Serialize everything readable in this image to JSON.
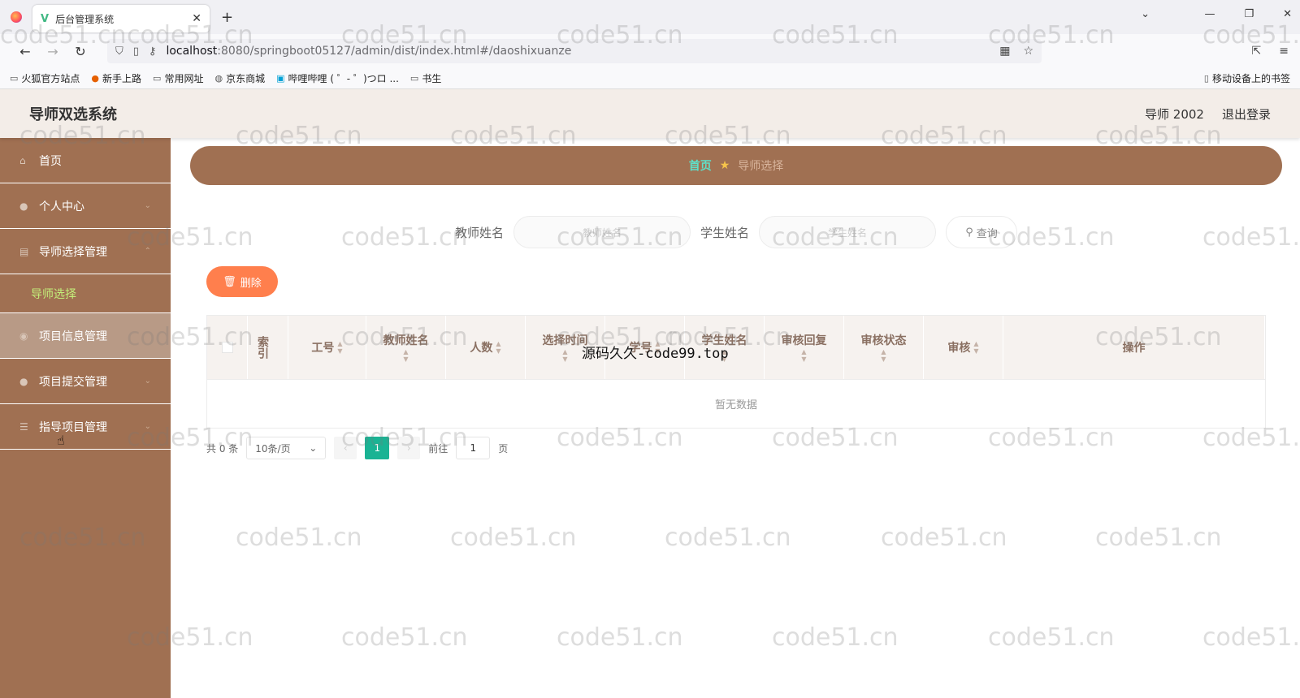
{
  "browser": {
    "tab_title": "后台管理系统",
    "url_host": "localhost",
    "url_path": ":8080/springboot05127/admin/dist/index.html#/daoshixuanze",
    "bookmarks": [
      "火狐官方站点",
      "新手上路",
      "常用网址",
      "京东商城",
      "哔哩哔哩 ( ゜- ゜)つロ ...",
      "书生"
    ],
    "mobile_bookmarks": "移动设备上的书签"
  },
  "header": {
    "title": "导师双选系统",
    "user": "导师 2002",
    "logout": "退出登录"
  },
  "sidebar": {
    "items": [
      {
        "label": "首页",
        "icon": "home-icon"
      },
      {
        "label": "个人中心",
        "icon": "user-icon"
      },
      {
        "label": "导师选择管理",
        "icon": "list-icon"
      },
      {
        "label": "导师选择",
        "sub": true
      },
      {
        "label": "项目信息管理",
        "icon": "info-icon"
      },
      {
        "label": "项目提交管理",
        "icon": "user-icon"
      },
      {
        "label": "指导项目管理",
        "icon": "menu-icon"
      }
    ]
  },
  "breadcrumb": {
    "home": "首页",
    "current": "导师选择"
  },
  "search": {
    "teacher_label": "教师姓名",
    "teacher_placeholder": "教师姓名",
    "student_label": "学生姓名",
    "student_placeholder": "学生姓名",
    "button": "查询"
  },
  "actions": {
    "delete": "删除"
  },
  "table": {
    "columns": [
      "索引",
      "工号",
      "教师姓名",
      "人数",
      "选择时间",
      "学号",
      "学生姓名",
      "审核回复",
      "审核状态",
      "审核",
      "操作"
    ],
    "empty_text": "暂无数据"
  },
  "pager": {
    "total": "共 0 条",
    "page_size": "10条/页",
    "current": "1",
    "goto_label": "前往",
    "goto_value": "1",
    "page_suffix": "页"
  },
  "overlay_text": "源码久久-code99.top",
  "watermark": "code51.cn"
}
